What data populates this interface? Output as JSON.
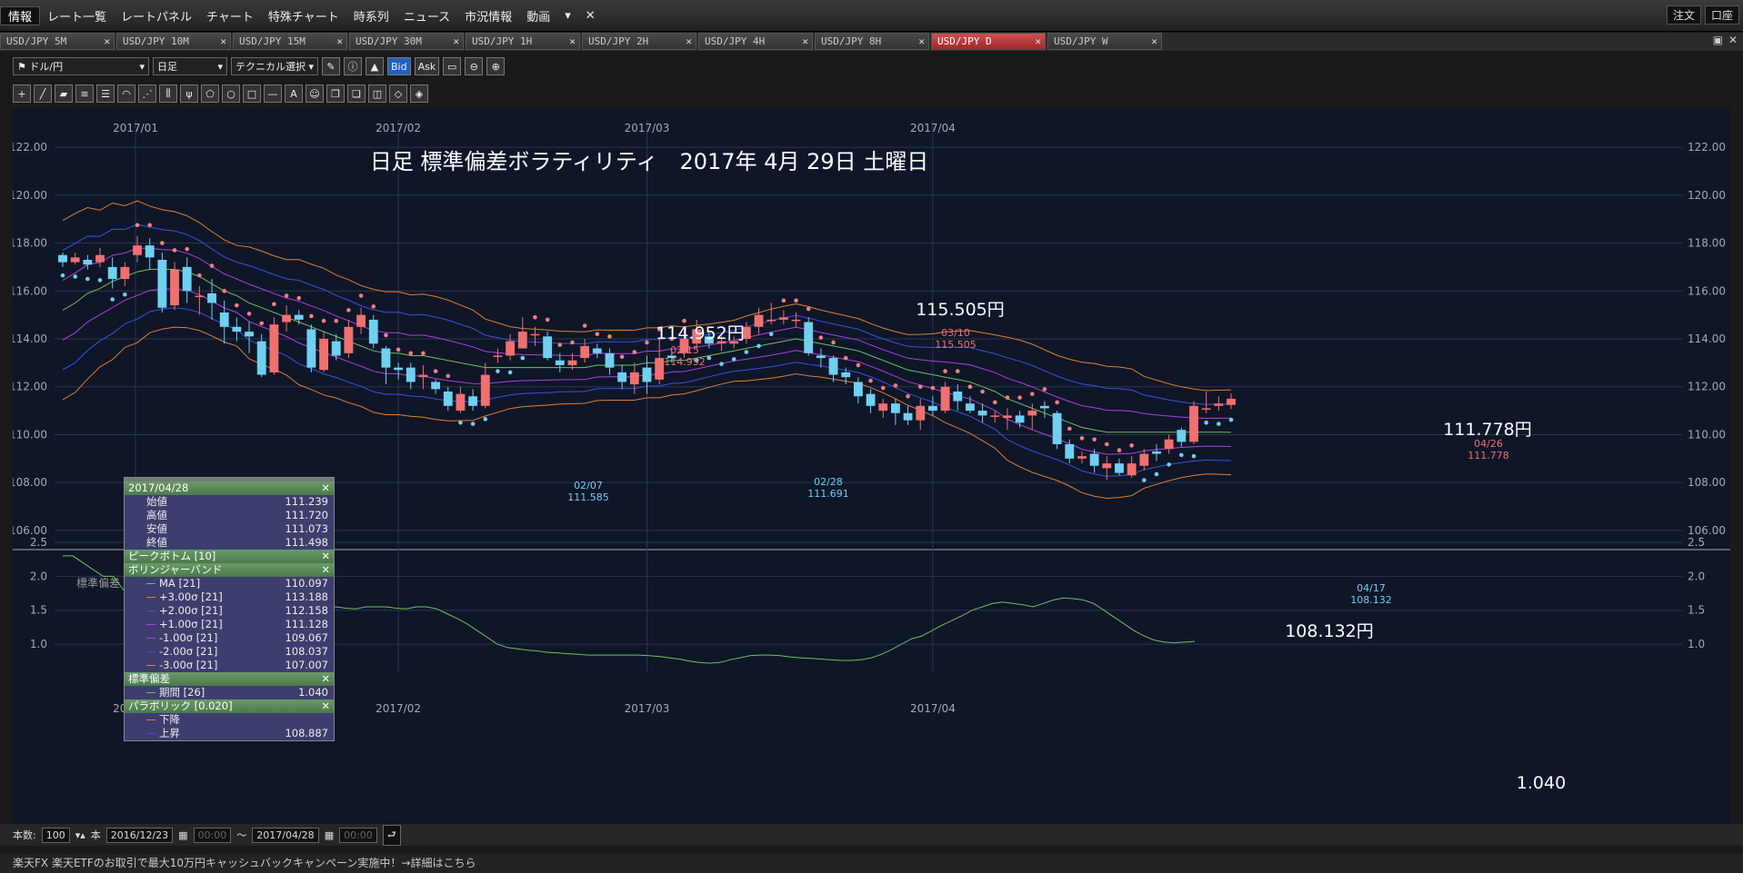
{
  "menubar": {
    "items": [
      "情報",
      "レート一覧",
      "レートパネル",
      "チャート",
      "特殊チャート",
      "時系列",
      "ニュース",
      "市況情報",
      "動画"
    ],
    "order_label": "注文",
    "account_label": "口座"
  },
  "tabs": [
    {
      "label": "USD/JPY 5M",
      "active": false
    },
    {
      "label": "USD/JPY 10M",
      "active": false
    },
    {
      "label": "USD/JPY 15M",
      "active": false
    },
    {
      "label": "USD/JPY 30M",
      "active": false
    },
    {
      "label": "USD/JPY 1H",
      "active": false
    },
    {
      "label": "USD/JPY 2H",
      "active": false
    },
    {
      "label": "USD/JPY 4H",
      "active": false
    },
    {
      "label": "USD/JPY 8H",
      "active": false
    },
    {
      "label": "USD/JPY D",
      "active": true
    },
    {
      "label": "USD/JPY W",
      "active": false
    }
  ],
  "toolbar": {
    "pair": "ドル/円",
    "period": "日足",
    "technical": "テクニカル選択",
    "bid": "Bid",
    "ask": "Ask"
  },
  "chart": {
    "title": "日足 標準偏差ボラティリティ　2017年 4月 29日 土曜日",
    "month_labels": [
      "2017/01",
      "2017/02",
      "2017/03",
      "2017/04"
    ],
    "y_ticks": [
      "122.00",
      "120.00",
      "118.00",
      "116.00",
      "114.00",
      "112.00",
      "110.00",
      "108.00",
      "106.00"
    ],
    "sub_ticks": [
      "2.5",
      "2.0",
      "1.5",
      "1.0"
    ],
    "sub_label": "標準偏差",
    "big_labels": [
      {
        "text": "114.952円"
      },
      {
        "text": "115.505円"
      },
      {
        "text": "111.778円"
      },
      {
        "text": "108.132円"
      }
    ],
    "peak_labels": [
      {
        "date": "02/15",
        "value": "114.952",
        "kind": "high"
      },
      {
        "date": "03/10",
        "value": "115.505",
        "kind": "high"
      },
      {
        "date": "04/26",
        "value": "111.778",
        "kind": "high"
      },
      {
        "date": "02/07",
        "value": "111.585",
        "kind": "low"
      },
      {
        "date": "02/28",
        "value": "111.691",
        "kind": "low"
      },
      {
        "date": "04/17",
        "value": "108.132",
        "kind": "low"
      }
    ],
    "sd_current": "1.040",
    "colors": {
      "up": "#f07070",
      "down": "#70d0f0",
      "ma": "#70c060",
      "s1": "#b040e0",
      "s2": "#4050e0",
      "s3": "#e08030",
      "sar_down": "#f08080",
      "sar_up": "#70d0f0"
    }
  },
  "chart_data": {
    "type": "candlestick",
    "title": "日足 標準偏差ボラティリティ　2017年 4月 29日 土曜日",
    "ylim": [
      105.2,
      122.8
    ],
    "sd_ylim": [
      0.6,
      2.5
    ],
    "candles": [
      [
        117.5,
        117.2,
        117.6,
        117.0
      ],
      [
        117.2,
        117.4,
        117.6,
        117.1
      ],
      [
        117.3,
        117.1,
        117.5,
        116.9
      ],
      [
        117.2,
        117.5,
        117.8,
        117.0
      ],
      [
        117.0,
        116.5,
        117.4,
        116.1
      ],
      [
        116.5,
        117.0,
        117.2,
        116.2
      ],
      [
        117.5,
        117.9,
        118.3,
        117.2
      ],
      [
        117.9,
        117.4,
        118.2,
        116.9
      ],
      [
        117.3,
        115.3,
        117.6,
        115.1
      ],
      [
        115.4,
        116.9,
        117.2,
        115.2
      ],
      [
        117.0,
        116.0,
        117.4,
        115.5
      ],
      [
        115.8,
        115.8,
        116.2,
        115.0
      ],
      [
        115.9,
        115.5,
        116.5,
        114.8
      ],
      [
        115.1,
        114.5,
        115.6,
        113.8
      ],
      [
        114.5,
        114.3,
        114.9,
        113.9
      ],
      [
        114.3,
        114.1,
        114.7,
        113.4
      ],
      [
        113.9,
        112.5,
        114.2,
        112.4
      ],
      [
        112.6,
        114.6,
        114.9,
        112.5
      ],
      [
        114.7,
        115.0,
        115.4,
        114.3
      ],
      [
        115.0,
        114.8,
        115.2,
        114.6
      ],
      [
        114.4,
        112.8,
        114.6,
        112.6
      ],
      [
        112.7,
        114.0,
        114.3,
        112.6
      ],
      [
        113.9,
        113.3,
        114.2,
        113.1
      ],
      [
        113.4,
        114.5,
        114.8,
        113.2
      ],
      [
        114.5,
        115.0,
        115.3,
        114.2
      ],
      [
        114.8,
        113.8,
        115.0,
        113.6
      ],
      [
        113.6,
        112.8,
        113.7,
        112.1
      ],
      [
        112.8,
        112.7,
        113.0,
        112.3
      ],
      [
        112.8,
        112.2,
        113.0,
        111.9
      ],
      [
        112.4,
        112.5,
        112.9,
        111.9
      ],
      [
        112.2,
        111.9,
        112.3,
        111.7
      ],
      [
        111.8,
        111.2,
        112.0,
        111.0
      ],
      [
        111.0,
        111.7,
        112.0,
        110.9
      ],
      [
        111.6,
        111.2,
        111.9,
        111.0
      ],
      [
        111.2,
        112.5,
        113.0,
        111.1
      ],
      [
        113.3,
        113.3,
        113.6,
        113.0
      ],
      [
        113.3,
        113.9,
        114.2,
        113.1
      ],
      [
        113.6,
        114.3,
        114.9,
        113.6
      ],
      [
        114.2,
        114.2,
        114.5,
        113.7
      ],
      [
        114.1,
        113.2,
        114.3,
        113.1
      ],
      [
        113.1,
        112.9,
        113.4,
        112.6
      ],
      [
        112.9,
        113.1,
        113.4,
        112.7
      ],
      [
        113.2,
        113.7,
        114.0,
        113.0
      ],
      [
        113.6,
        113.4,
        113.8,
        113.2
      ],
      [
        113.4,
        112.8,
        113.6,
        112.5
      ],
      [
        112.6,
        112.2,
        112.9,
        111.9
      ],
      [
        112.1,
        112.6,
        113.0,
        111.7
      ],
      [
        112.8,
        112.2,
        113.3,
        111.7
      ],
      [
        112.3,
        113.2,
        114.0,
        112.1
      ],
      [
        113.3,
        113.2,
        113.5,
        113.0
      ],
      [
        113.4,
        114.0,
        114.4,
        113.2
      ],
      [
        113.8,
        114.4,
        114.8,
        113.6
      ],
      [
        114.1,
        113.8,
        114.3,
        113.6
      ],
      [
        113.8,
        113.9,
        114.1,
        113.5
      ],
      [
        113.8,
        113.9,
        114.1,
        113.6
      ],
      [
        114.0,
        114.5,
        114.7,
        113.8
      ],
      [
        114.5,
        115.0,
        115.3,
        114.2
      ],
      [
        114.8,
        114.8,
        115.5,
        114.6
      ],
      [
        114.8,
        114.9,
        115.2,
        114.6
      ],
      [
        114.8,
        114.8,
        115.1,
        114.5
      ],
      [
        114.7,
        113.4,
        114.9,
        113.3
      ],
      [
        113.3,
        113.2,
        113.6,
        112.8
      ],
      [
        113.2,
        112.5,
        113.3,
        112.2
      ],
      [
        112.6,
        112.4,
        112.8,
        112.1
      ],
      [
        112.2,
        111.6,
        112.4,
        111.3
      ],
      [
        111.7,
        111.2,
        111.9,
        110.9
      ],
      [
        111.0,
        111.3,
        111.5,
        110.7
      ],
      [
        111.3,
        110.9,
        111.5,
        110.4
      ],
      [
        110.9,
        110.6,
        111.2,
        110.4
      ],
      [
        110.6,
        111.2,
        111.5,
        110.2
      ],
      [
        111.2,
        111.0,
        111.6,
        110.8
      ],
      [
        111.0,
        112.0,
        112.2,
        110.9
      ],
      [
        111.8,
        111.4,
        112.1,
        111.0
      ],
      [
        111.3,
        111.0,
        111.6,
        110.9
      ],
      [
        111.0,
        110.8,
        111.3,
        110.5
      ],
      [
        110.8,
        110.8,
        111.0,
        110.5
      ],
      [
        110.7,
        110.8,
        111.1,
        110.2
      ],
      [
        110.8,
        110.5,
        111.0,
        110.3
      ],
      [
        110.8,
        111.0,
        111.3,
        110.2
      ],
      [
        111.2,
        111.1,
        111.4,
        110.7
      ],
      [
        110.9,
        109.6,
        111.0,
        109.4
      ],
      [
        109.6,
        109.0,
        109.8,
        108.8
      ],
      [
        109.0,
        109.1,
        109.3,
        108.8
      ],
      [
        109.2,
        108.7,
        109.4,
        108.4
      ],
      [
        108.6,
        108.8,
        109.1,
        108.1
      ],
      [
        108.8,
        108.4,
        109.0,
        108.3
      ],
      [
        108.3,
        108.8,
        109.1,
        108.2
      ],
      [
        108.7,
        109.2,
        109.4,
        108.5
      ],
      [
        109.3,
        109.2,
        109.6,
        108.9
      ],
      [
        109.4,
        109.8,
        110.0,
        109.2
      ],
      [
        110.2,
        109.7,
        110.3,
        109.5
      ],
      [
        109.7,
        111.2,
        111.4,
        109.6
      ],
      [
        111.1,
        111.1,
        111.8,
        110.9
      ],
      [
        111.2,
        111.3,
        111.6,
        111.0
      ],
      [
        111.24,
        111.5,
        111.72,
        111.07
      ]
    ],
    "ma21": [
      115.2,
      115.5,
      115.9,
      116.1,
      116.4,
      116.6,
      116.8,
      116.9,
      116.9,
      116.9,
      116.8,
      116.6,
      116.3,
      116.0,
      115.8,
      115.5,
      115.3,
      115.1,
      114.9,
      114.7,
      114.5,
      114.3,
      114.1,
      113.9,
      113.7,
      113.5,
      113.4,
      113.4,
      113.3,
      113.3,
      113.2,
      113.1,
      113.0,
      112.9,
      112.8,
      112.8,
      112.8,
      112.8,
      112.8,
      112.8,
      112.8,
      112.8,
      112.8,
      112.9,
      112.9,
      112.9,
      112.9,
      113.0,
      113.0,
      113.1,
      113.1,
      113.2,
      113.3,
      113.4,
      113.5,
      113.6,
      113.7,
      113.8,
      113.9,
      114.0,
      113.9,
      113.8,
      113.7,
      113.6,
      113.5,
      113.3,
      113.1,
      112.9,
      112.7,
      112.6,
      112.5,
      112.4,
      112.3,
      112.2,
      112.0,
      111.8,
      111.5,
      111.3,
      111.1,
      110.9,
      110.7,
      110.5,
      110.3,
      110.2,
      110.1,
      110.1,
      110.1,
      110.1,
      110.1,
      110.1,
      110.1,
      110.1,
      110.1,
      110.1,
      110.097
    ],
    "sd": [
      2.3,
      2.3,
      2.2,
      2.1,
      2.0,
      2.0,
      1.8,
      1.8,
      1.6,
      1.55,
      1.5,
      1.45,
      1.4,
      1.35,
      1.3,
      1.27,
      1.25,
      1.25,
      1.4,
      1.42,
      1.42,
      1.45,
      1.5,
      1.58,
      1.58,
      1.6,
      1.55,
      1.55,
      1.53,
      1.52,
      1.55,
      1.55,
      1.55,
      1.53,
      1.52,
      1.55,
      1.55,
      1.52,
      1.45,
      1.38,
      1.3,
      1.2,
      1.1,
      1.0,
      0.95,
      0.93,
      0.91,
      0.9,
      0.88,
      0.87,
      0.86,
      0.85,
      0.84,
      0.84,
      0.84,
      0.84,
      0.84,
      0.84,
      0.83,
      0.82,
      0.8,
      0.78,
      0.75,
      0.73,
      0.72,
      0.73,
      0.77,
      0.8,
      0.83,
      0.84,
      0.84,
      0.83,
      0.81,
      0.8,
      0.79,
      0.78,
      0.77,
      0.76,
      0.76,
      0.77,
      0.8,
      0.85,
      0.92,
      1.0,
      1.08,
      1.12,
      1.2,
      1.28,
      1.35,
      1.42,
      1.5,
      1.55,
      1.6,
      1.62,
      1.6,
      1.58,
      1.55,
      1.6,
      1.65,
      1.68,
      1.67,
      1.65,
      1.6,
      1.5,
      1.4,
      1.3,
      1.2,
      1.12,
      1.06,
      1.03,
      1.02,
      1.03,
      1.04
    ],
    "ohlc_panel": {
      "date": "2017/04/28",
      "open": "111.239",
      "high": "111.720",
      "low": "111.073",
      "close": "111.498"
    }
  },
  "ohlc_panel": {
    "date": "2017/04/28",
    "rows": [
      {
        "label": "始値",
        "value": "111.239"
      },
      {
        "label": "高値",
        "value": "111.720"
      },
      {
        "label": "安値",
        "value": "111.073"
      },
      {
        "label": "終値",
        "value": "111.498"
      }
    ],
    "peak_bottom": "ピークボトム [10]",
    "bollinger": "ボリンジャーバンド",
    "bb_rows": [
      {
        "label": "MA [21]",
        "value": "110.097",
        "color": "#70c060"
      },
      {
        "label": "+3.00σ [21]",
        "value": "113.188",
        "color": "#e08030"
      },
      {
        "label": "+2.00σ [21]",
        "value": "112.158",
        "color": "#4050e0"
      },
      {
        "label": "+1.00σ [21]",
        "value": "111.128",
        "color": "#b040e0"
      },
      {
        "label": "-1.00σ [21]",
        "value": "109.067",
        "color": "#b040e0"
      },
      {
        "label": "-2.00σ [21]",
        "value": "108.037",
        "color": "#4050e0"
      },
      {
        "label": "-3.00σ [21]",
        "value": "107.007",
        "color": "#e08030"
      }
    ],
    "sd_title": "標準偏差",
    "sd_rows": [
      {
        "label": "期間 [26]",
        "value": "1.040",
        "color": "#70c060"
      }
    ],
    "sar_title": "パラボリック [0.020]",
    "sar_rows": [
      {
        "label": "下降",
        "value": "",
        "color": "#f07070"
      },
      {
        "label": "上昇",
        "value": "108.887",
        "color": "#4050e0"
      }
    ]
  },
  "bottom": {
    "count_label": "本数:",
    "count_value": "100",
    "unit": "本",
    "from_date": "2016/12/23",
    "from_time": "00:00",
    "tilde": "～",
    "to_date": "2017/04/28",
    "to_time": "00:00"
  },
  "status_text": "楽天FX 楽天ETFのお取引で最大10万円キャッシュバックキャンペーン実施中！→詳細はこちら"
}
